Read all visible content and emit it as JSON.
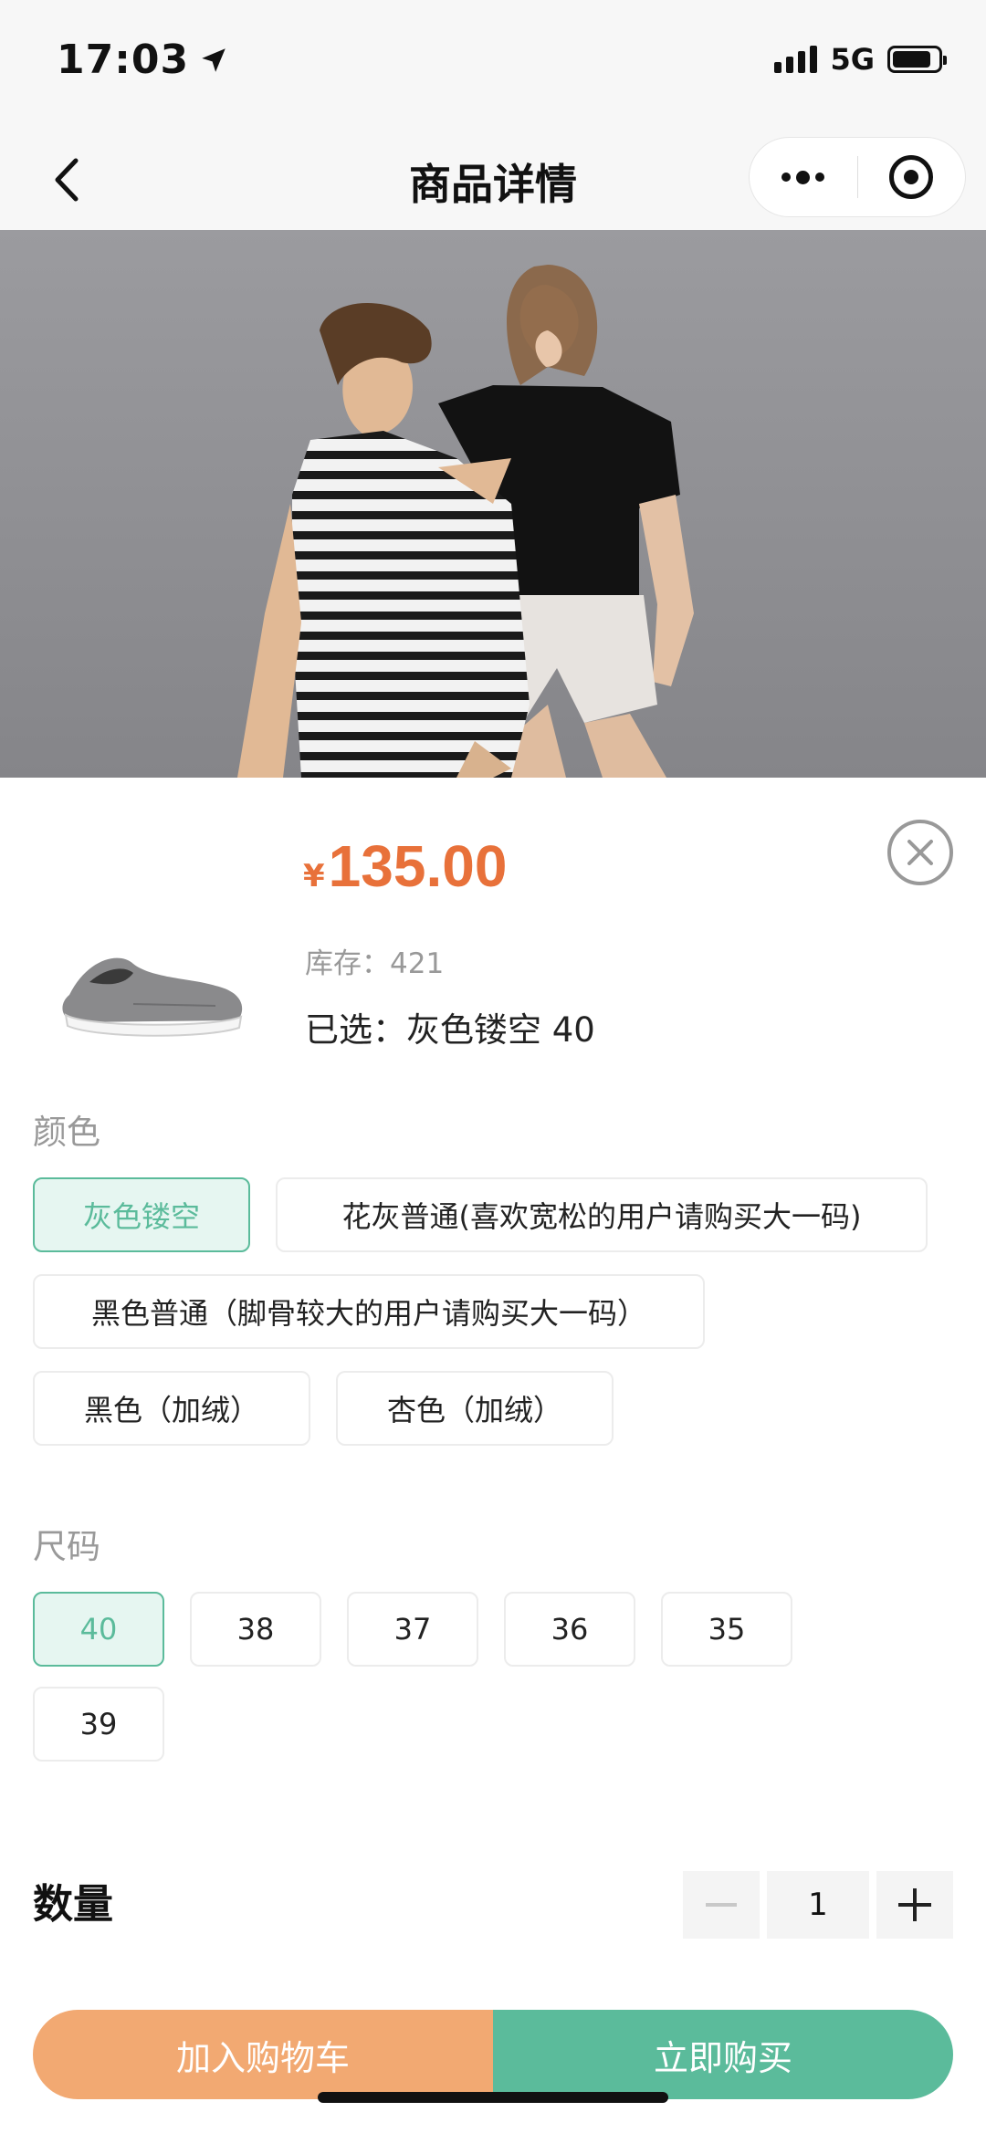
{
  "status_bar": {
    "time": "17:03",
    "network": "5G"
  },
  "nav": {
    "title": "商品详情"
  },
  "product": {
    "currency": "¥",
    "price": "135.00",
    "stock": "库存：421",
    "selected": "已选：灰色镂空 40"
  },
  "color_section": {
    "label": "颜色",
    "options": [
      "灰色镂空",
      "花灰普通(喜欢宽松的用户请购买大一码)",
      "黑色普通（脚骨较大的用户请购买大一码）",
      "黑色（加绒）",
      "杏色（加绒）"
    ],
    "selected": "灰色镂空"
  },
  "size_section": {
    "label": "尺码",
    "options": [
      "40",
      "38",
      "37",
      "36",
      "35",
      "39"
    ],
    "selected": "40"
  },
  "quantity": {
    "label": "数量",
    "value": "1"
  },
  "actions": {
    "add_to_cart": "加入购物车",
    "buy_now": "立即购买"
  },
  "colors": {
    "price": "#e8713a",
    "accent_green": "#5bbb9b",
    "cart_orange": "#f2a972"
  },
  "icons": [
    "location-arrow-icon",
    "signal-icon",
    "battery-icon",
    "back-chevron-icon",
    "more-dots-icon",
    "miniprogram-close-icon",
    "close-circle-icon",
    "minus-icon",
    "plus-icon"
  ]
}
